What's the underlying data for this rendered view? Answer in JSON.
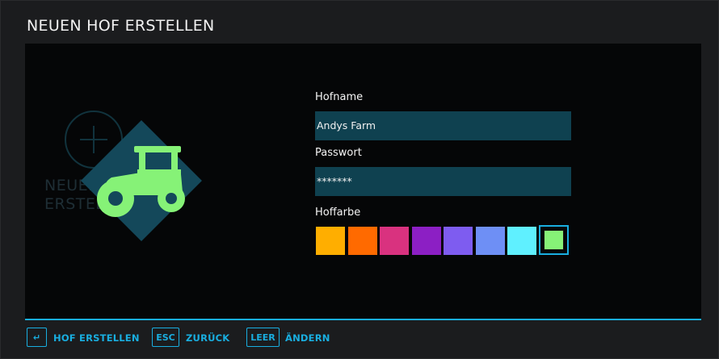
{
  "dialog": {
    "title": "NEUEN HOF ERSTELLEN"
  },
  "background_card": {
    "label_line1": "NEUEN",
    "label_line2": "ERSTELLEN"
  },
  "form": {
    "farm_name_label": "Hofname",
    "farm_name_value": "Andys Farm",
    "password_label": "Passwort",
    "password_value": "*******",
    "color_label": "Hoffarbe",
    "colors": [
      "#ffae00",
      "#ff6a00",
      "#d9327f",
      "#8c1fc4",
      "#7e5cf0",
      "#6e8ff5",
      "#5ff0ff",
      "#86f277"
    ],
    "selected_color_index": 7
  },
  "footer": {
    "actions": [
      {
        "key": "↵",
        "label": "HOF ERSTELLEN"
      },
      {
        "key": "ESC",
        "label": "ZURÜCK"
      },
      {
        "key": "LEER",
        "label": "ÄNDERN"
      }
    ]
  },
  "accent_color": "#19aee0",
  "icon": "tractor-icon"
}
